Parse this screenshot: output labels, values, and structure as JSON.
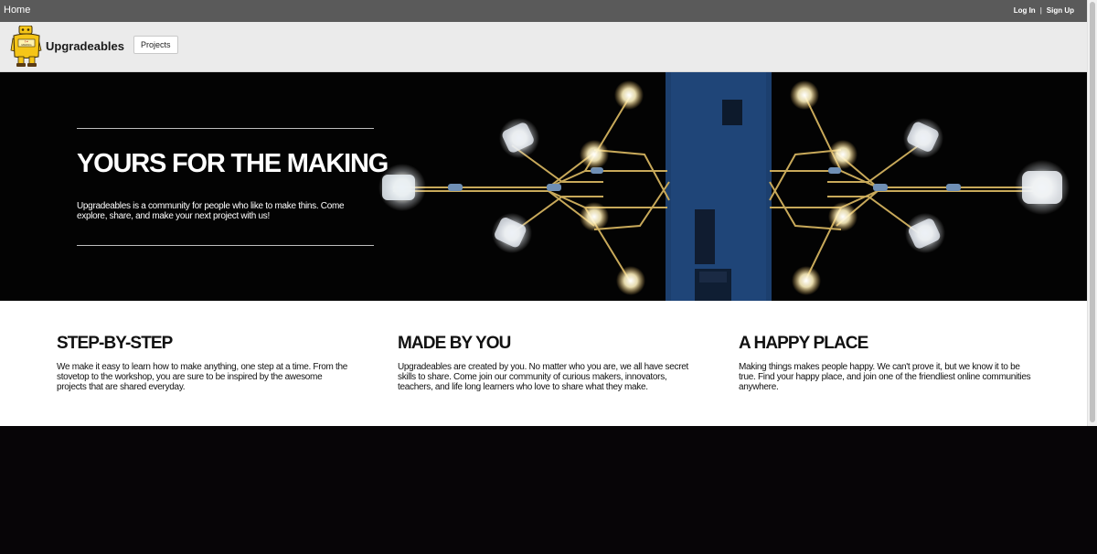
{
  "topbar": {
    "home_label": "Home",
    "login_label": "Log In",
    "separator": "|",
    "signup_label": "Sign Up"
  },
  "header": {
    "logo_icon": "robot-mascot-logo",
    "logo_text": "I ♥ MAKING",
    "brand_name": "Upgradeables",
    "projects_label": "Projects"
  },
  "hero": {
    "title": "YOURS FOR THE MAKING",
    "subtitle": "Upgradeables is a community for people who like to make thins. Come explore, share, and make your next project with us!",
    "image": "led-circuit-board-photo"
  },
  "features": [
    {
      "title": "STEP-BY-STEP",
      "body": "We make it easy to learn how to make anything, one step at a time. From the stovetop to the workshop, you are sure to be inspired by the awesome projects that are shared everyday."
    },
    {
      "title": "MADE BY YOU",
      "body": "Upgradeables are created by you. No matter who you are, we all have secret skills to share. Come join our community of curious makers, innovators, teachers, and life long learners who love to share what they make."
    },
    {
      "title": "A HAPPY PLACE",
      "body": "Making things makes people happy. We can't prove it, but we know it to be true. Find your happy place, and join one of the friendliest online communities anywhere."
    }
  ],
  "colors": {
    "topbar_bg": "#5a5a5a",
    "header_bg": "#ebebeb",
    "hero_bg": "#030303",
    "mascot_yellow": "#f5c518",
    "wire_gold": "#b89a4a",
    "pcb_blue": "#1c3f6e"
  }
}
